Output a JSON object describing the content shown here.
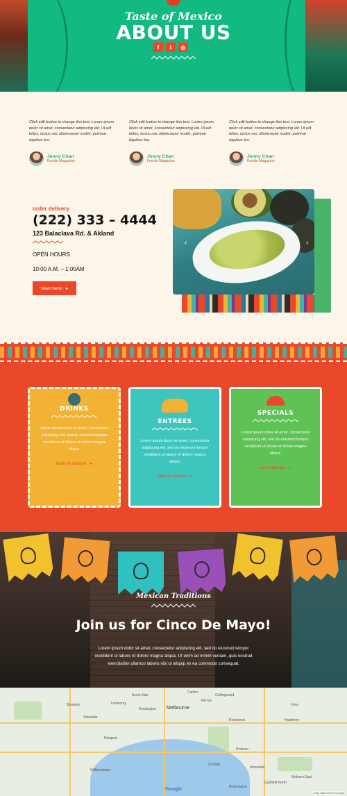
{
  "hero": {
    "subtitle": "Taste of Mexico",
    "title": "ABOUT US",
    "social": [
      {
        "icon": "facebook-icon",
        "glyph": "f"
      },
      {
        "icon": "twitter-icon",
        "glyph": "t"
      },
      {
        "icon": "instagram-icon",
        "glyph": "◎"
      }
    ]
  },
  "testimonials": [
    {
      "text": "Click edit button to change this text. Lorem ipsum dolor sit amet, consectetur adipiscing elit. Ut elit tellus, luctus nec ullamcorper mattis, pulvinar dapibus leo.",
      "name": "Jenny Chan",
      "source": "Foodie Magazine"
    },
    {
      "text": "Click edit button to change this text. Lorem ipsum dolor sit amet, consectetur adipiscing elit. Ut elit tellus, luctus nec ullamcorper mattis, pulvinar dapibus leo.",
      "name": "Jenny Chan",
      "source": "Foodie Magazine"
    },
    {
      "text": "Click edit button to change this text. Lorem ipsum dolor sit amet, consectetur adipiscing elit. Ut elit tellus, luctus nec ullamcorper mattis, pulvinar dapibus leo.",
      "name": "Jenny Chan",
      "source": "Foodie Magazine"
    }
  ],
  "contact": {
    "order_label": "order delivery",
    "phone": "(222) 333 – 4444",
    "address": "123 Balaclava Rd. & Akland",
    "hours_label": "OPEN HOURS",
    "hours": "10:00 A.M. – 1:00AM",
    "menu_button": "view menu"
  },
  "menu_cards": {
    "drinks": {
      "title": "DRINKS",
      "text": "Lorem ipsum dolor sit amet, consectetur adipiscing elit, sed do eiusmod tempor incididunt ut labore et dolore magna aliqua.",
      "link": "hours & location"
    },
    "entrees": {
      "title": "ENTREES",
      "text": "Lorem ipsum dolor sit amet, consectetur adipiscing elit, sed do eiusmod tempor incididunt ut labore et dolore magna aliqua.",
      "link": "view our menus"
    },
    "specials": {
      "title": "SPECIALS",
      "text": "Lorem ipsum dolor sit amet, consectetur adipiscing elit, sed do eiusmod tempor incididunt ut labore et dolore magna aliqua.",
      "link": "view specials"
    }
  },
  "traditions": {
    "subtitle": "Mexican Traditions",
    "title": "Join us for Cinco De Mayo!",
    "body": "Lorem ipsum dolor sit amet, consectetur adipiscing elit, sed do eiusmod tempor incididunt ut labore et dolore magna aliqua. Ut enim ad minim veniam, quis nostrud exercitation ullamco laboris nisi ut aliquip ex ea commodo consequat."
  },
  "map": {
    "city": "Melbourne",
    "provider": "Google",
    "credit": "Map data ©2019 Google",
    "labels": [
      "Brooklyn",
      "Footscray",
      "Newport",
      "Williamstown",
      "Richmond",
      "Hawthorn",
      "Kew",
      "Collingwood",
      "Fitzroy",
      "St Kilda",
      "Elsternwick",
      "Malvern East",
      "Yarraville",
      "Kensington",
      "Ascot Vale",
      "Carlton",
      "Prahran",
      "Armadale",
      "Caulfield North"
    ]
  },
  "colors": {
    "primary_green": "#13b983",
    "accent_orange": "#e9492a",
    "drinks_yellow": "#f2b233",
    "entrees_teal": "#3ec5bd",
    "specials_green": "#5fc255",
    "cream": "#fbf5ea"
  }
}
